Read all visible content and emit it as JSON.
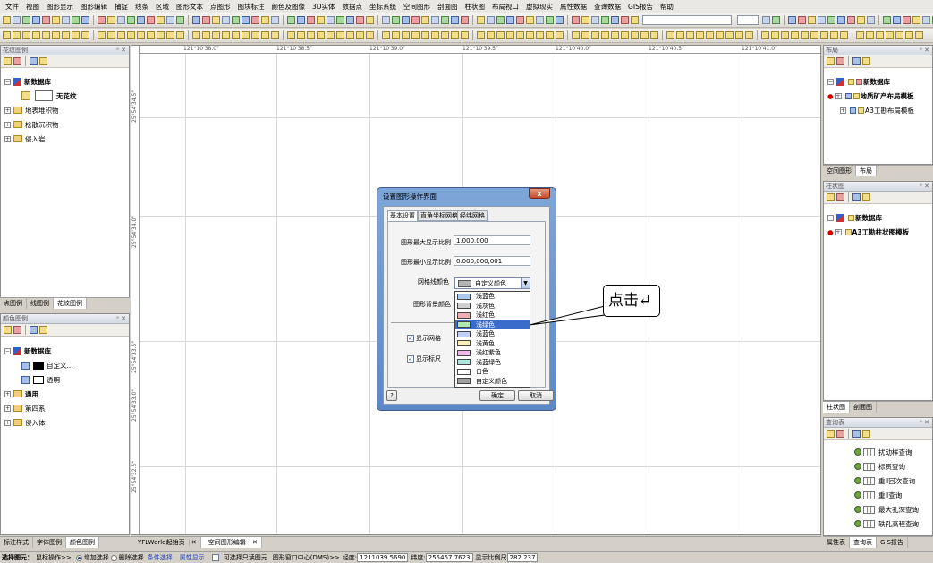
{
  "menubar": {
    "items": [
      "文件",
      "视图",
      "图形显示",
      "图形编辑",
      "捕捉",
      "线条",
      "区域",
      "图形文本",
      "点图形",
      "图块标注",
      "颜色及图像",
      "3D实体",
      "数据点",
      "坐标系统",
      "空间图形",
      "剖面图",
      "柱状图",
      "布局视口",
      "虚拟现实",
      "属性数据",
      "查询数据",
      "GIS报告",
      "帮助"
    ]
  },
  "left_top_panel": {
    "title": "花纹图例",
    "tree": [
      {
        "label": "新数据库",
        "bold": true
      },
      {
        "label": "无花纹",
        "bold": true
      },
      {
        "label": "地表堆积物"
      },
      {
        "label": "松散沉积物"
      },
      {
        "label": "侵入岩"
      }
    ],
    "tabs": [
      "点图例",
      "线图例",
      "花纹图例"
    ]
  },
  "left_bottom_panel": {
    "title": "颜色图例",
    "tree": [
      {
        "label": "新数据库",
        "bold": true
      },
      {
        "label": "自定义..."
      },
      {
        "label": "透明"
      },
      {
        "label": "通用",
        "bold": true
      },
      {
        "label": "第四系"
      },
      {
        "label": "侵入体"
      }
    ],
    "tabs": [
      "标注样式",
      "字体图例",
      "颜色图例"
    ]
  },
  "right_top_panel": {
    "title": "布局",
    "tree": [
      {
        "label": "新数据库",
        "bold": true
      },
      {
        "label": "地质矿产布局模板",
        "bold": true
      },
      {
        "label": "A3工勘布局模板"
      }
    ],
    "tabs": [
      "空间图形",
      "布局"
    ]
  },
  "right_mid_panel": {
    "title": "柱状图",
    "tree": [
      {
        "label": "新数据库",
        "bold": true
      },
      {
        "label": "A3工勘柱状图模板",
        "bold": true
      }
    ],
    "tabs": [
      "柱状图",
      "剖面图"
    ]
  },
  "right_bottom_panel": {
    "title": "查询表",
    "items": [
      "扰动样查询",
      "标贯查询",
      "重Ⅱ回次查询",
      "重Ⅱ查询",
      "最大孔深查询",
      "轶孔高程查询"
    ],
    "tabs": [
      "属性表",
      "查询表",
      "GIS报告"
    ]
  },
  "canvas": {
    "top_ruler": [
      "121°10'38.0\"",
      "121°10'38.5\"",
      "121°10'39.0\"",
      "121°10'39.5\"",
      "121°10'40.0\"",
      "121°10'40.5\"",
      "121°10'41.0\""
    ],
    "left_ruler": [
      "25°54'34.5\"",
      "25°54'34.0\"",
      "25°54'33.5\"",
      "25°54'33.0\"",
      "25°54'32.5\""
    ]
  },
  "doc_tabs": [
    "YFLWorld起始页",
    "空间图形编辑"
  ],
  "dialog": {
    "title": "设置图形操作界面",
    "close": "x",
    "tabs": [
      "基本设置",
      "直角坐标网格",
      "经纬网格"
    ],
    "max_scale_label": "图形最大显示比例",
    "max_scale_value": "1,000,000",
    "min_scale_label": "图形最小显示比例",
    "min_scale_value": "0.000,000,001",
    "grid_color_label": "网格线颜色",
    "grid_color_value": "自定义颜色",
    "bg_color_label": "图形背景颜色",
    "show_grid": "显示网格",
    "show_ruler": "显示标尺",
    "ok": "确定",
    "cancel": "取消",
    "help": "?"
  },
  "color_list": [
    {
      "name": "浅蓝色",
      "color": "#a8c8f0"
    },
    {
      "name": "浅灰色",
      "color": "#d0d0d0"
    },
    {
      "name": "浅红色",
      "color": "#f0b0b0"
    },
    {
      "name": "浅绿色",
      "color": "#b0e8b0",
      "selected": true
    },
    {
      "name": "浅蓝色",
      "color": "#c0d0f8"
    },
    {
      "name": "浅黄色",
      "color": "#f8f0b8"
    },
    {
      "name": "浅红紫色",
      "color": "#f0b8e8"
    },
    {
      "name": "浅蓝绿色",
      "color": "#b0e8e0"
    },
    {
      "name": "白色",
      "color": "#ffffff"
    },
    {
      "name": "自定义颜色",
      "color": "#a0a0a0"
    }
  ],
  "callout": {
    "text": "点击↵"
  },
  "status": {
    "label": "选择图元：",
    "mode": "鼠标操作>>",
    "opt1": "增加选择",
    "opt2": "删除选择",
    "link1": "条件选择",
    "link2": "属性显示",
    "check": "可选择只读图元",
    "center": "图形窗口中心(DMS)>>",
    "lon_label": "经度:",
    "lon": "1211039.5690",
    "lat_label": "纬度:",
    "lat": "255457.7623",
    "scale_label": "显示比例尺",
    "scale": "282.237"
  },
  "colors": {
    "accent": "#3a6ccc",
    "dialog_frame": "#6a92cc",
    "close_red": "#c44a2a"
  }
}
